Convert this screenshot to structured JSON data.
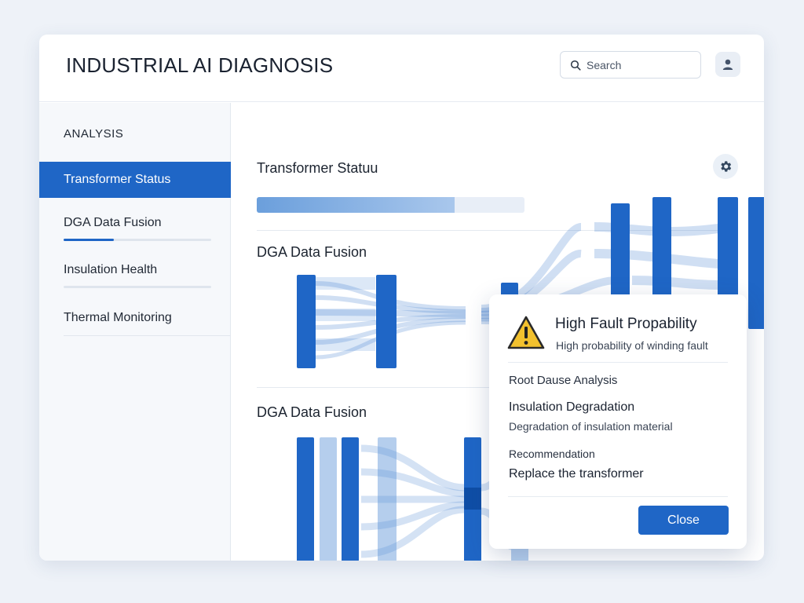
{
  "app": {
    "title": "INDUSTRIAL AI DIAGNOSIS"
  },
  "search": {
    "placeholder": "Search"
  },
  "icons": {
    "search": "search-icon",
    "user": "user-icon",
    "settings": "gear-icon",
    "warning": "warning-icon"
  },
  "colors": {
    "accent": "#1f66c6",
    "warning": "#f2c12e"
  },
  "sidebar": {
    "heading": "ANALYSIS",
    "items": [
      {
        "label": "Transformer Status",
        "active": true
      },
      {
        "label": "DGA Data Fusion",
        "progress": 0.34
      },
      {
        "label": "Insulation Health"
      },
      {
        "label": "Thermal Monitoring"
      }
    ]
  },
  "main": {
    "sections": [
      {
        "title": "Transformer Statuu",
        "progress": 0.74
      },
      {
        "title": "DGA Data Fusion"
      },
      {
        "title": "DGA Data Fusion"
      }
    ]
  },
  "modal": {
    "title": "High Fault Propability",
    "subtitle": "High probability of winding fault",
    "root_cause_label": "Root Dause Analysis",
    "root_cause_title": "Insulation Degradation",
    "root_cause_desc": "Degradation of insulation material",
    "recommendation_label": "Recommendation",
    "recommendation_text": "Replace the transformer",
    "close_label": "Close"
  }
}
